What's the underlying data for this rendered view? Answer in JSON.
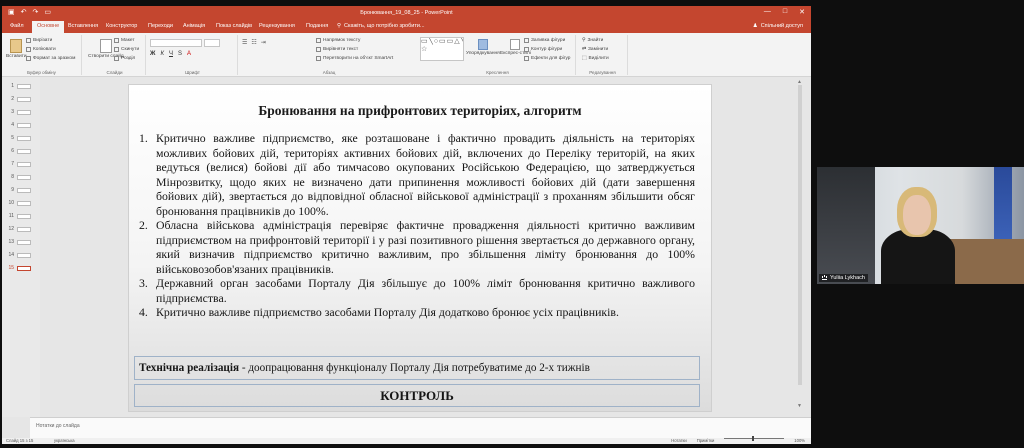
{
  "window": {
    "title": "Бронювання_19_08_25 - PowerPoint",
    "controls": [
      "—",
      "□",
      "✕"
    ]
  },
  "tabs": [
    {
      "label": "Файл"
    },
    {
      "label": "Основне",
      "active": true
    },
    {
      "label": "Вставлення"
    },
    {
      "label": "Конструктор"
    },
    {
      "label": "Переходи"
    },
    {
      "label": "Анімація"
    },
    {
      "label": "Показ слайдів"
    },
    {
      "label": "Рецензування"
    },
    {
      "label": "Подання"
    }
  ],
  "tell_me": "Скажіть, що потрібно зробити...",
  "share": "Спільний доступ",
  "ribbon": {
    "clipboard": {
      "paste": "Вставити",
      "cut": "Вирізати",
      "copy": "Копіювати",
      "format": "Формат за зразком",
      "label": "Буфер обміну"
    },
    "slides": {
      "new_slide": "Створити слайд",
      "layout": "Макет",
      "reset": "Скинути",
      "section": "Розділ",
      "label": "Слайди"
    },
    "font": {
      "label": "Шрифт"
    },
    "paragraph": {
      "text_direction": "Напрямок тексту",
      "align_text": "Вирівняти текст",
      "smartart": "Перетворити на об'єкт SmartArt",
      "label": "Абзац"
    },
    "drawing": {
      "arrange": "Упорядкування",
      "quick_styles": "Експрес-стилі",
      "shape_fill": "Заливка фігури",
      "shape_outline": "Контур фігури",
      "shape_effects": "Ефекти для фігур",
      "label": "Креслення"
    },
    "editing": {
      "find": "Знайти",
      "replace": "Замінити",
      "select": "Виділити",
      "label": "Редагування"
    }
  },
  "thumbnails": [
    {
      "n": "1"
    },
    {
      "n": "2"
    },
    {
      "n": "3"
    },
    {
      "n": "4"
    },
    {
      "n": "5"
    },
    {
      "n": "6"
    },
    {
      "n": "7"
    },
    {
      "n": "8"
    },
    {
      "n": "9"
    },
    {
      "n": "10"
    },
    {
      "n": "11"
    },
    {
      "n": "12"
    },
    {
      "n": "13"
    },
    {
      "n": "14"
    },
    {
      "n": "15",
      "active": true
    }
  ],
  "slide": {
    "title": "Бронювання на прифронтових територіях, алгоритм",
    "items": [
      {
        "num": "1.",
        "text": "Критично важливе підприємство, яке розташоване і фактично провадить діяльність на територіях можливих бойових дій, територіях активних бойових дій, включених до Переліку територій, на яких ведуться (велися) бойові дії або тимчасово окупованих Російською Федерацією, що затверджується Мінрозвитку, щодо яких не визначено дати припинення можливості бойових дій (дати завершення бойових дій), звертається до відповідної обласної військової адміністрації з проханням збільшити обсяг бронювання працівників до 100%."
      },
      {
        "num": "2.",
        "text": "Обласна військова адміністрація перевіряє фактичне провадження діяльності критично важливим підприємством на прифронтовій території і у разі позитивного рішення звертається до державного органу, який визначив підприємство критично важливим, про збільшення ліміту бронювання до 100% військовозобов'язаних працівників."
      },
      {
        "num": "3.",
        "text": "Державний орган засобами Порталу Дія збільшує до 100% ліміт бронювання критично важливого підприємства."
      },
      {
        "num": "4.",
        "text": "Критично важливе підприємство засобами Порталу Дія додатково бронює усіх працівників."
      }
    ],
    "tech_label": "Технічна реалізація",
    "tech_text": " - доопрацювання функціоналу Порталу Дія потребуватиме до 2-х тижнів",
    "control": "КОНТРОЛЬ"
  },
  "notes_placeholder": "Нотатки до слайда",
  "status": {
    "slide_counter": "Слайд 15 з 15",
    "language": "українська",
    "notes": "Нотатки",
    "comments": "Примітки",
    "zoom": "100%"
  },
  "video": {
    "participant": "Yuliia Lykhach"
  },
  "colors": {
    "accent": "#c4462f"
  }
}
